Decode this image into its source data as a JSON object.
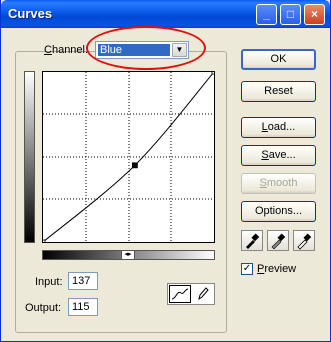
{
  "window": {
    "title": "Curves",
    "minimize_glyph": "_",
    "maximize_glyph": "□",
    "close_glyph": "×"
  },
  "channel": {
    "label_underlined": "C",
    "label_rest": "hannel:",
    "selected": "Blue",
    "arrow_glyph": "▼"
  },
  "curve": {
    "points": [
      [
        0,
        0
      ],
      [
        137,
        115
      ],
      [
        255,
        255
      ]
    ]
  },
  "inputs": {
    "input_label": "Input:",
    "input_value": "137",
    "output_label": "Output:",
    "output_value": "115"
  },
  "ramp_toggle_glyph": "◂▸",
  "buttons": {
    "ok": "OK",
    "reset": "Reset",
    "load_u": "L",
    "load_rest": "oad...",
    "save_u": "S",
    "save_rest": "ave...",
    "smooth_u": "S",
    "smooth_rest": "mooth",
    "options": "Options..."
  },
  "preview": {
    "checked": true,
    "check_glyph": "✓",
    "label_u": "P",
    "label_rest": "review"
  },
  "colors": {
    "title_bar": "#0a58e6",
    "selection": "#316ac5",
    "highlight_ellipse": "#e01010"
  }
}
